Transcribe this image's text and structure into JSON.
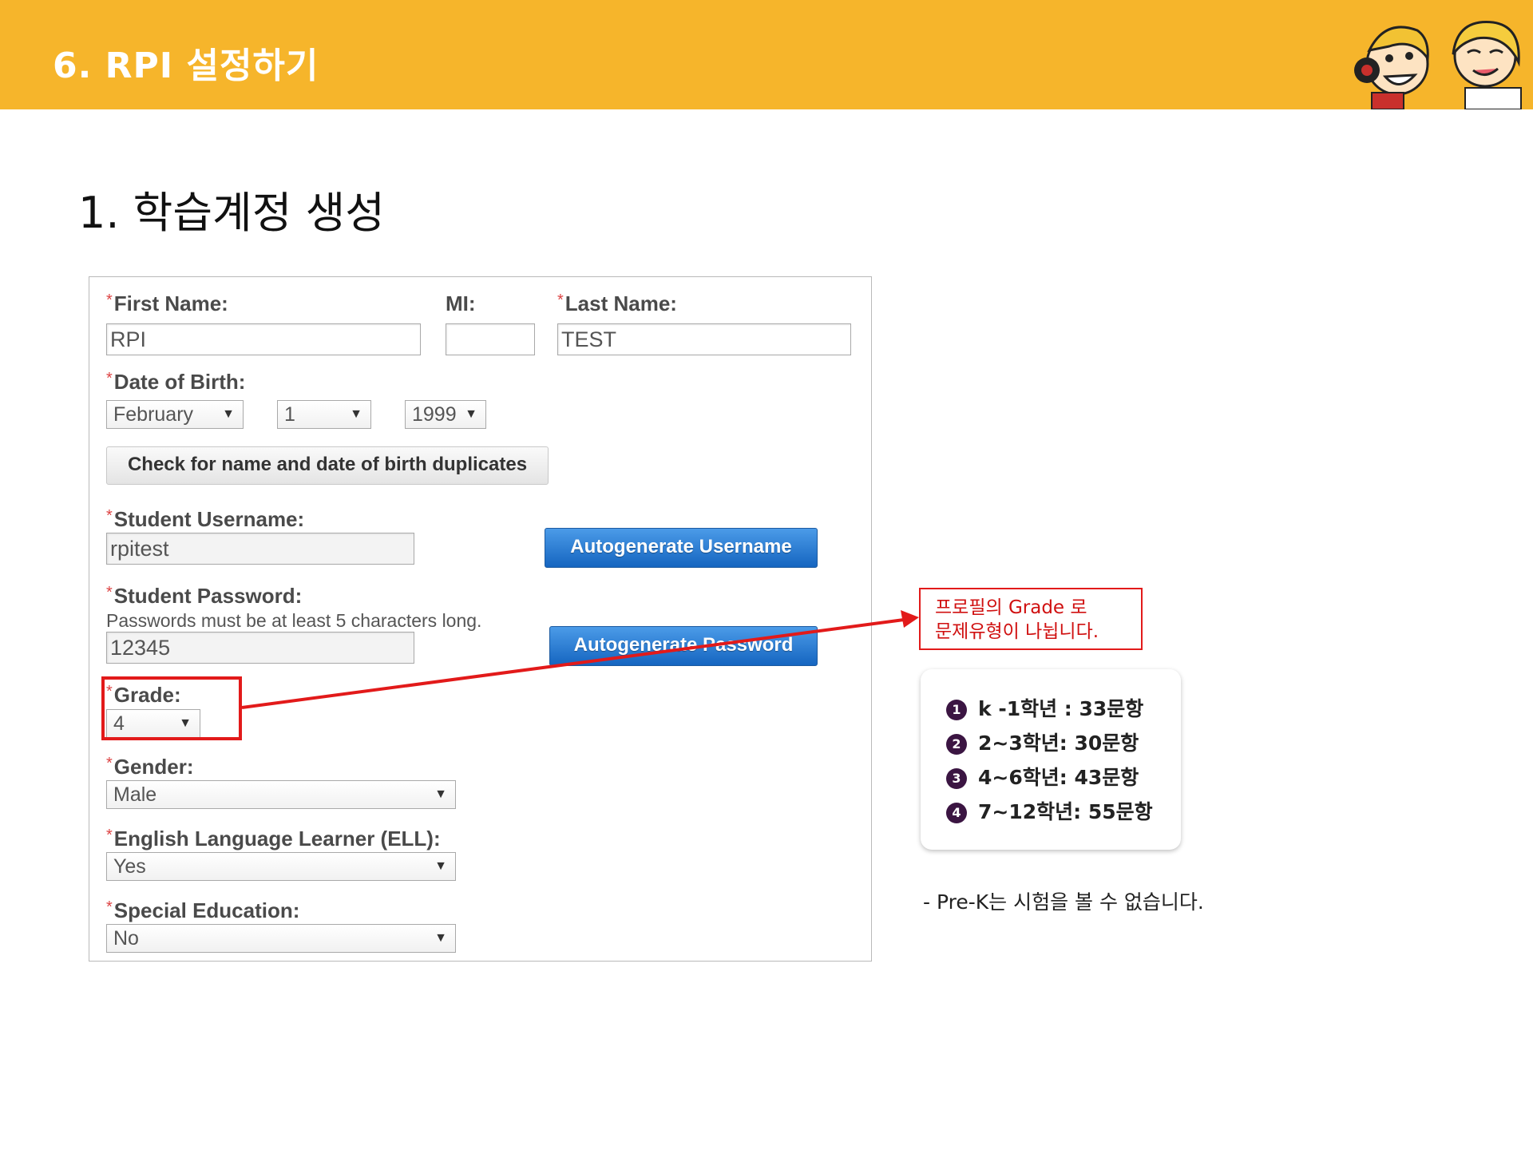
{
  "header": {
    "title": "6. RPI 설정하기",
    "band_color": "#f6b52b"
  },
  "section": {
    "title": "1. 학습계정 생성"
  },
  "form": {
    "required_mark": "*",
    "first_name": {
      "label": "First Name:",
      "value": "RPI"
    },
    "mi": {
      "label": "MI:",
      "value": ""
    },
    "last_name": {
      "label": "Last Name:",
      "value": "TEST"
    },
    "dob": {
      "label": "Date of Birth:",
      "month": "February",
      "day": "1",
      "year": "1999"
    },
    "duplicate_button": "Check for name and date of birth duplicates",
    "username": {
      "label": "Student Username:",
      "value": "rpitest",
      "autogen_button": "Autogenerate Username"
    },
    "password": {
      "label": "Student Password:",
      "hint": "Passwords must be at least 5 characters long.",
      "value": "12345",
      "autogen_button": "Autogenerate Password"
    },
    "grade": {
      "label": "Grade:",
      "value": "4"
    },
    "gender": {
      "label": "Gender:",
      "value": "Male"
    },
    "ell": {
      "label": "English Language Learner (ELL):",
      "value": "Yes"
    },
    "special_ed": {
      "label": "Special Education:",
      "value": "No"
    },
    "dropdown_arrow": "▼",
    "button_color": "#1565c0"
  },
  "callout": {
    "line1": "프로필의 Grade 로",
    "line2": "문제유형이 나뉩니다.",
    "color": "#e21a1a"
  },
  "grade_list": [
    {
      "num": "1",
      "text": "k -1학년 : 33문항"
    },
    {
      "num": "2",
      "text": "2~3학년: 30문항"
    },
    {
      "num": "3",
      "text": "4~6학년: 43문항"
    },
    {
      "num": "4",
      "text": "7~12학년: 55문항"
    }
  ],
  "note": "- Pre-K는 시험을 볼 수 없습니다."
}
